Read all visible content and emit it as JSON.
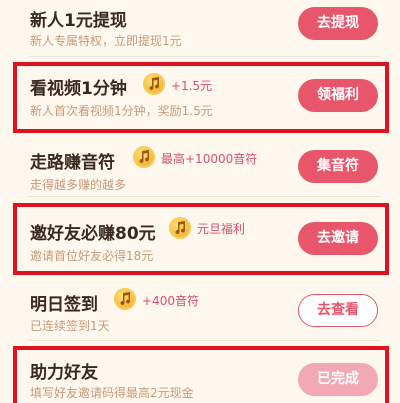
{
  "tasks": [
    {
      "title": "新人1元提现",
      "subtitle": "新人专属特权，立即提现1元",
      "reward": "",
      "button": "去提现",
      "style": "filled"
    },
    {
      "title": "看视频1分钟",
      "subtitle": "新人首次看视频1分钟，奖励1.5元",
      "reward": "+1.5元",
      "button": "领福利",
      "style": "filled"
    },
    {
      "title": "走路赚音符",
      "subtitle": "走得越多赚的越多",
      "reward": "最高+10000音符",
      "button": "集音符",
      "style": "filled"
    },
    {
      "title": "邀好友必赚80元",
      "subtitle": "邀请首位好友必得18元",
      "reward": "元旦福利",
      "button": "去邀请",
      "style": "filled"
    },
    {
      "title": "明日签到",
      "subtitle": "已连续签到1天",
      "reward": "+400音符",
      "button": "去查看",
      "style": "outline"
    },
    {
      "title": "助力好友",
      "subtitle": "填写好友邀请码得最高2元现金",
      "reward": "",
      "button": "已完成",
      "style": "done"
    }
  ],
  "colors": {
    "accent": "#e8566c",
    "highlight": "#e0121f",
    "title": "#3a2a1e",
    "subtitle": "#c79a7a",
    "background": "#fff8ee"
  },
  "icons": [
    "music-note-coin-icon"
  ]
}
